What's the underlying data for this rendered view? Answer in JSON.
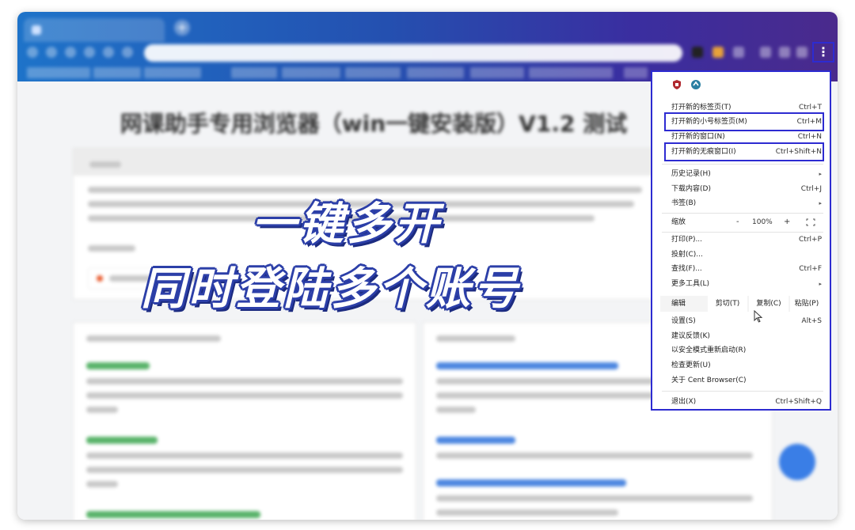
{
  "menu": {
    "items": [
      {
        "label": "打开新的标签页(T)",
        "shortcut": "Ctrl+T"
      },
      {
        "label": "打开新的小号标签页(M)",
        "shortcut": "Ctrl+M"
      },
      {
        "label": "打开新的窗口(N)",
        "shortcut": "Ctrl+N"
      },
      {
        "label": "打开新的无痕窗口(I)",
        "shortcut": "Ctrl+Shift+N"
      },
      {
        "label": "历史记录(H)",
        "shortcut": ""
      },
      {
        "label": "下载内容(D)",
        "shortcut": "Ctrl+J"
      },
      {
        "label": "书签(B)",
        "shortcut": ""
      },
      {
        "label": "打印(P)...",
        "shortcut": "Ctrl+P"
      },
      {
        "label": "投射(C)...",
        "shortcut": ""
      },
      {
        "label": "查找(F)...",
        "shortcut": "Ctrl+F"
      },
      {
        "label": "更多工具(L)",
        "shortcut": ""
      },
      {
        "label": "设置(S)",
        "shortcut": "Alt+S"
      },
      {
        "label": "建议反馈(K)",
        "shortcut": ""
      },
      {
        "label": "以安全模式重新启动(R)",
        "shortcut": ""
      },
      {
        "label": "检查更新(U)",
        "shortcut": ""
      },
      {
        "label": "关于 Cent Browser(C)",
        "shortcut": ""
      },
      {
        "label": "退出(X)",
        "shortcut": "Ctrl+Shift+Q"
      }
    ],
    "zoom": {
      "label": "缩放",
      "minus": "-",
      "value": "100%",
      "plus": "+"
    },
    "edit": {
      "label": "编辑",
      "cut": "剪切(T)",
      "copy": "复制(C)",
      "paste": "粘贴(P)"
    },
    "submenu_arrow": "▸"
  },
  "overlay": {
    "line1": "一键多开",
    "line2": "同时登陆多个账号"
  },
  "page": {
    "title": "网课助手专用浏览器（win一键安装版）V1.2 测试"
  },
  "toolbar": {
    "menu_button": "⋮",
    "new_tab": "+"
  },
  "colors": {
    "highlight": "#2d2bd1",
    "overlay_stroke": "#2c3fa8"
  }
}
